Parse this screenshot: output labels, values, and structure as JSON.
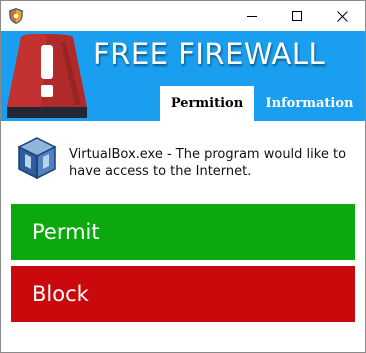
{
  "window": {
    "icon": "shield-icon",
    "controls": {
      "minimize": "minimize-icon",
      "maximize": "maximize-icon",
      "close": "close-icon"
    }
  },
  "header": {
    "title": "FREE FIREWALL",
    "logo": "alarm-light-icon",
    "background_color": "#1a9ff0",
    "tabs": [
      {
        "label": "Permition",
        "active": true
      },
      {
        "label": "Information",
        "active": false
      }
    ]
  },
  "message": {
    "icon": "virtualbox-icon",
    "text": "VirtualBox.exe - The program would like to have access to the Internet."
  },
  "actions": {
    "permit_label": "Permit",
    "permit_color": "#0ba80e",
    "block_label": "Block",
    "block_color": "#c9090b"
  }
}
